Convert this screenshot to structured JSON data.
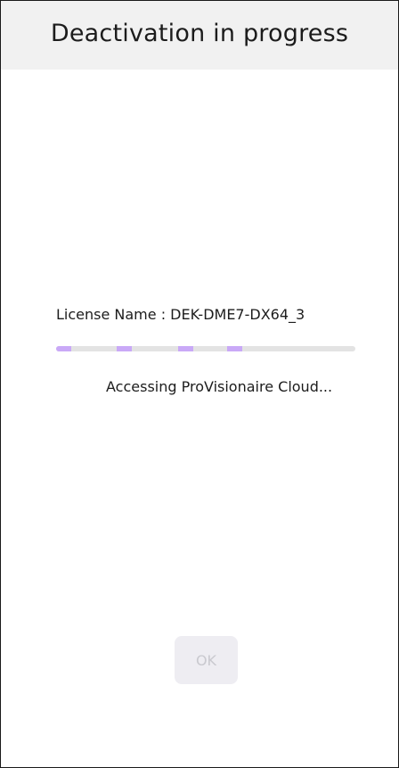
{
  "dialog": {
    "title": "Deactivation in progress",
    "license_label": "License Name : DEK-DME7-DX64_3",
    "status_text": "Accessing ProVisionaire Cloud...",
    "ok_label": "OK",
    "ok_enabled": false
  },
  "progress": {
    "mode": "indeterminate",
    "track_color": "#e3e3e3",
    "indicator_color": "#c9a9f7"
  },
  "colors": {
    "header_background": "#f1f1f1",
    "button_background": "#eeedf2",
    "button_text_disabled": "#c9c9cf"
  }
}
